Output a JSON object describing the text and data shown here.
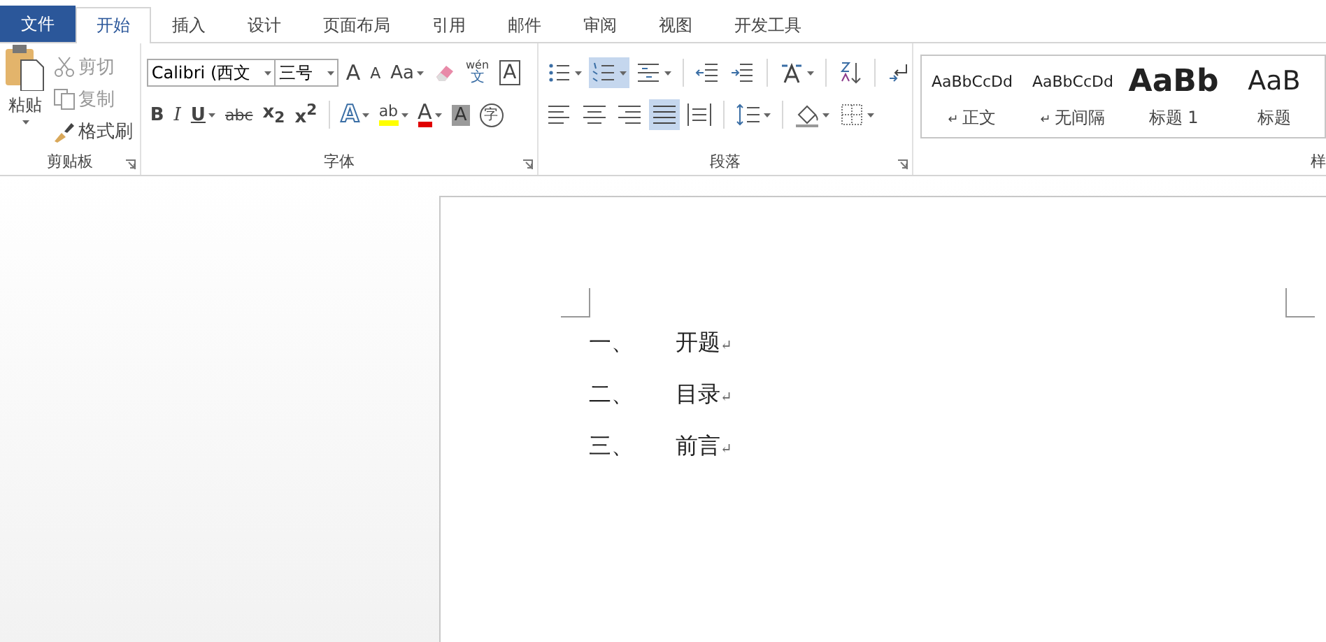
{
  "tabs": [
    {
      "label": "文件",
      "kind": "file",
      "selected": false
    },
    {
      "label": "开始",
      "kind": "tab",
      "selected": true
    },
    {
      "label": "插入",
      "kind": "tab",
      "selected": false
    },
    {
      "label": "设计",
      "kind": "tab",
      "selected": false
    },
    {
      "label": "页面布局",
      "kind": "tab",
      "selected": false
    },
    {
      "label": "引用",
      "kind": "tab",
      "selected": false
    },
    {
      "label": "邮件",
      "kind": "tab",
      "selected": false
    },
    {
      "label": "审阅",
      "kind": "tab",
      "selected": false
    },
    {
      "label": "视图",
      "kind": "tab",
      "selected": false
    },
    {
      "label": "开发工具",
      "kind": "tab",
      "selected": false
    }
  ],
  "clipboard": {
    "paste": "粘贴",
    "cut": "剪切",
    "copy": "复制",
    "format_painter": "格式刷",
    "label": "剪贴板"
  },
  "font": {
    "name": "Calibri (西文",
    "size": "三号",
    "label": "字体",
    "row1": [
      {
        "kind": "grow",
        "label": "A"
      },
      {
        "kind": "shrink",
        "label": "A"
      },
      {
        "kind": "case",
        "label": "Aa",
        "menu": true
      },
      {
        "kind": "eraser"
      },
      {
        "kind": "phonetic",
        "label": "wén",
        "sub": "文"
      },
      {
        "kind": "boxed",
        "label": "A"
      }
    ],
    "row2": [
      {
        "kind": "bold",
        "label": "B"
      },
      {
        "kind": "italic",
        "label": "I"
      },
      {
        "kind": "underline",
        "label": "U",
        "menu": true
      },
      {
        "kind": "strike",
        "label": "abc"
      },
      {
        "kind": "plain",
        "label": "x$_{2}$"
      },
      {
        "kind": "plain",
        "label": "x$^{2}$"
      },
      {
        "kind": "sep"
      },
      {
        "kind": "effects",
        "label": "A",
        "menu": true
      },
      {
        "kind": "highlight",
        "label": "ab",
        "menu": true
      },
      {
        "kind": "fontcolor",
        "label": "A",
        "menu": true
      },
      {
        "kind": "shaded",
        "label": "A"
      },
      {
        "kind": "circled",
        "label": "字"
      }
    ]
  },
  "paragraph": {
    "label": "段落",
    "row1": [
      {
        "kind": "bullets",
        "menu": true,
        "selected": false
      },
      {
        "kind": "numbering",
        "menu": true,
        "selected": true
      },
      {
        "kind": "multilevel",
        "menu": true,
        "selected": false
      },
      {
        "kind": "sep"
      },
      {
        "kind": "outdent",
        "selected": false
      },
      {
        "kind": "indent",
        "selected": false
      },
      {
        "kind": "sep"
      },
      {
        "kind": "asian",
        "menu": true,
        "selected": false
      },
      {
        "kind": "sep"
      },
      {
        "kind": "sort",
        "selected": false
      },
      {
        "kind": "sep"
      },
      {
        "kind": "marks",
        "selected": false
      }
    ],
    "row2": [
      {
        "kind": "left",
        "selected": false
      },
      {
        "kind": "center",
        "selected": false
      },
      {
        "kind": "right",
        "selected": false
      },
      {
        "kind": "justify",
        "selected": true
      },
      {
        "kind": "distributed",
        "selected": false
      },
      {
        "kind": "sep"
      },
      {
        "kind": "spacing",
        "menu": true,
        "selected": false
      },
      {
        "kind": "sep"
      },
      {
        "kind": "shading",
        "menu": true,
        "selected": false
      },
      {
        "kind": "borders",
        "menu": true,
        "selected": false
      }
    ]
  },
  "styles": {
    "label": "样",
    "items": [
      {
        "preview": "AaBbCcDd",
        "name": "正文",
        "kind": "normal",
        "mark": "↵"
      },
      {
        "preview": "AaBbCcDd",
        "name": "无间隔",
        "kind": "normal",
        "mark": "↵"
      },
      {
        "preview": "AaBb",
        "name": "标题 1",
        "kind": "heading1"
      },
      {
        "preview": "AaB",
        "name": "标题",
        "kind": "heading2"
      }
    ]
  },
  "document": {
    "lines": [
      {
        "number": "一、",
        "text": "开题",
        "mark": "↵"
      },
      {
        "number": "二、",
        "text": "目录",
        "mark": "↵"
      },
      {
        "number": "三、",
        "text": "前言",
        "mark": "↵"
      }
    ]
  }
}
